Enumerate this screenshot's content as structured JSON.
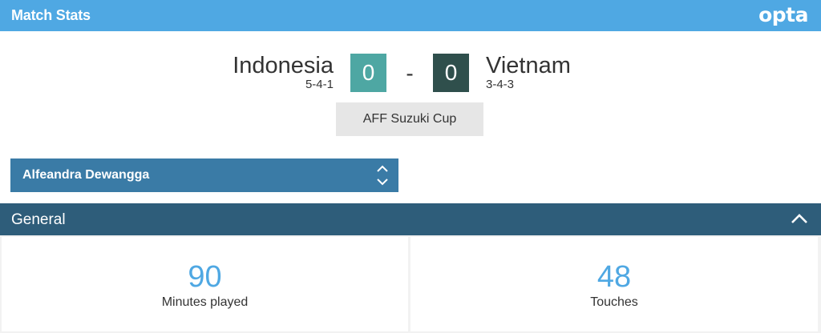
{
  "header": {
    "title": "Match Stats",
    "brand": "opta",
    "brand_color": "#4fa8e3"
  },
  "match": {
    "home": {
      "name": "Indonesia",
      "formation": "5-4-1",
      "score": "0",
      "color": "#4ea7a3"
    },
    "away": {
      "name": "Vietnam",
      "formation": "3-4-3",
      "score": "0",
      "color": "#2f4f4c"
    },
    "separator": "-",
    "competition": "AFF Suzuki Cup"
  },
  "player_select": {
    "selected": "Alfeandra Dewangga",
    "icon": "up-down-chevron-icon"
  },
  "section": {
    "label": "General",
    "icon": "chevron-up-icon",
    "color": "#2e5d7a"
  },
  "stats": [
    {
      "value": "90",
      "label": "Minutes played"
    },
    {
      "value": "48",
      "label": "Touches"
    }
  ]
}
